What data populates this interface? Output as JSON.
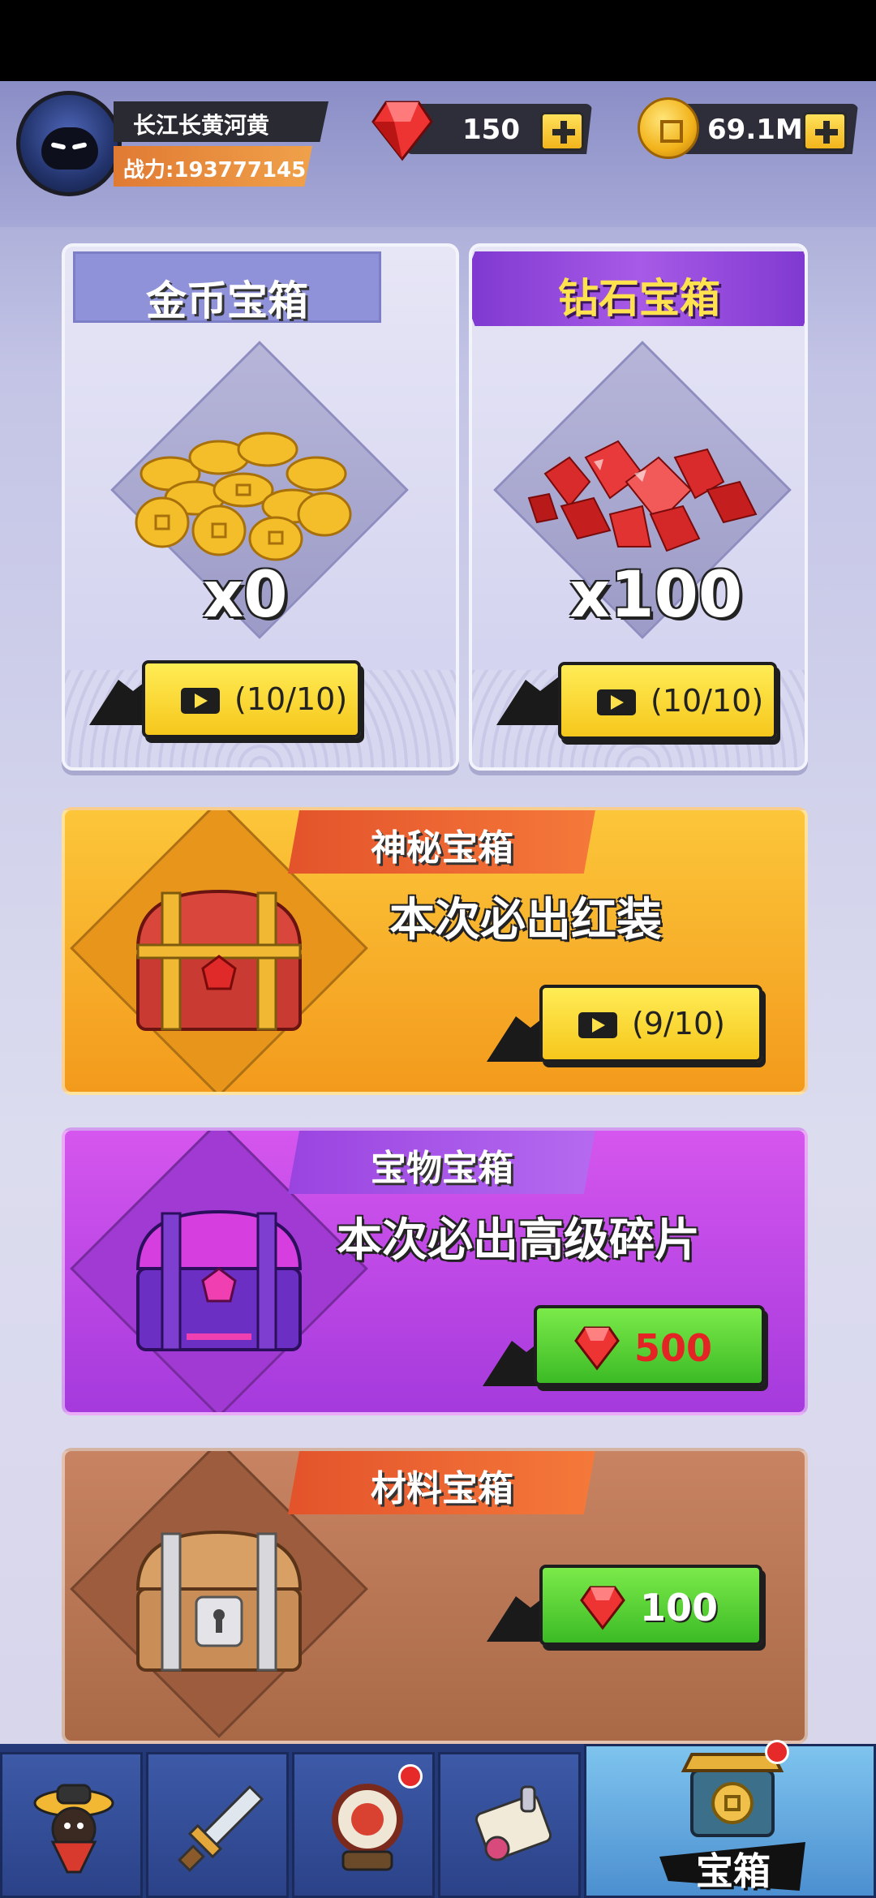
{
  "colors": {
    "gold_card": "#f4a321",
    "gem_card": "#b640e6",
    "material_card": "#b57755",
    "button_yellow": "#f6c71c",
    "button_green": "#3cbb25",
    "price_red": "#e42424"
  },
  "header": {
    "player_name": "长江长黄河黄",
    "power_label": "战力:193777145",
    "gems": "150",
    "coins": "69.1M"
  },
  "cards": {
    "gold_chest": {
      "title": "金币宝箱",
      "count": "x0",
      "button": "(10/10)"
    },
    "gem_chest": {
      "title": "钻石宝箱",
      "count": "x100",
      "button": "(10/10)"
    },
    "mystery_chest": {
      "title": "神秘宝箱",
      "promo": "本次必出红装",
      "button": "(9/10)"
    },
    "treasure_chest": {
      "title": "宝物宝箱",
      "promo": "本次必出高级碎片",
      "price": "500"
    },
    "material_chest": {
      "title": "材料宝箱",
      "price": "100"
    }
  },
  "nav": {
    "active_label": "宝箱",
    "tabs": [
      "hero",
      "weapon",
      "drum",
      "scroll",
      "chest"
    ]
  }
}
